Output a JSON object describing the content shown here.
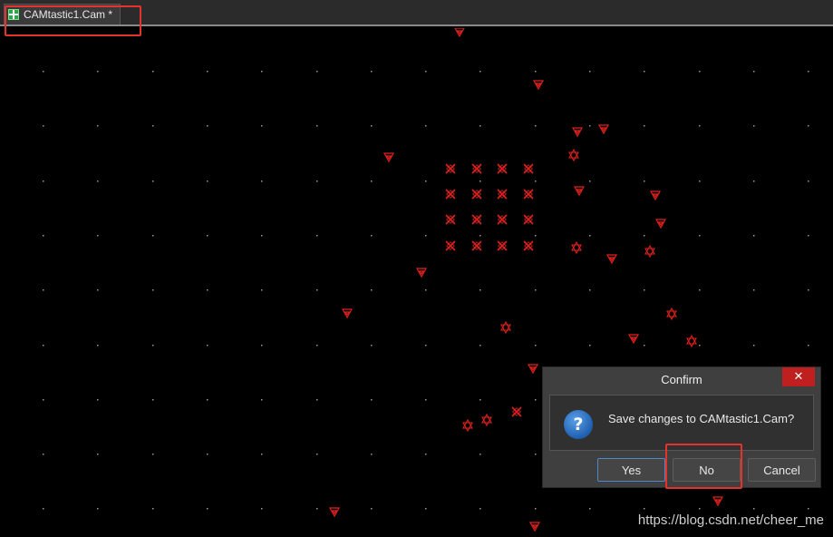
{
  "tab": {
    "title": "CAMtastic1.Cam *",
    "icon": "spreadsheet-icon"
  },
  "dialog": {
    "title": "Confirm",
    "close_icon": "close-icon",
    "question_icon": "question-icon",
    "question_glyph": "?",
    "close_glyph": "✕",
    "message": "Save changes to CAMtastic1.Cam?",
    "buttons": {
      "yes": "Yes",
      "no": "No",
      "cancel": "Cancel"
    }
  },
  "watermark": "https://blog.csdn.net/cheer_me",
  "colors": {
    "canvas_bg": "#000000",
    "grid_dot": "#9a9a9a",
    "marker": "#e0201c",
    "highlight": "#e5322d",
    "close_button": "#c01f1f",
    "primary_button_border": "#4f88c6"
  },
  "canvas": {
    "marker_types": [
      "triangle-marker",
      "star-marker",
      "cross-marker"
    ]
  }
}
